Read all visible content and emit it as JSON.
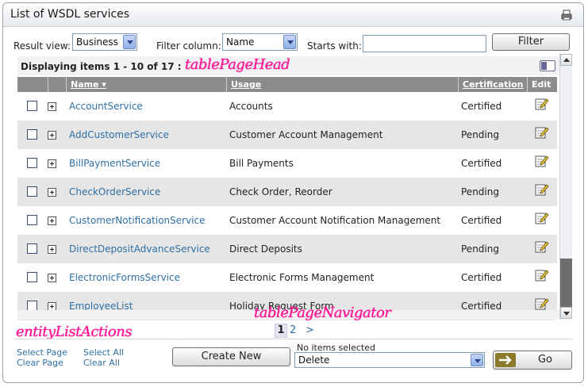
{
  "panel": {
    "title": "List of WSDL services",
    "print_icon": "printer-icon"
  },
  "filters": {
    "result_view_label": "Result view:",
    "result_view_value": "Business",
    "filter_column_label": "Filter column:",
    "filter_column_value": "Name",
    "starts_with_label": "Starts with:",
    "starts_with_value": "",
    "filter_button": "Filter"
  },
  "table": {
    "display_text": "Displaying items 1 - 10 of 17 :",
    "columns": {
      "name": "Name",
      "name_sort_indicator": "▾",
      "usage": "Usage",
      "certification": "Certification",
      "edit": "Edit"
    },
    "rows": [
      {
        "name": "AccountService",
        "usage": "Accounts",
        "certification": "Certified"
      },
      {
        "name": "AddCustomerService",
        "usage": "Customer Account Management",
        "certification": "Pending"
      },
      {
        "name": "BillPaymentService",
        "usage": "Bill Payments",
        "certification": "Certified"
      },
      {
        "name": "CheckOrderService",
        "usage": "Check Order, Reorder",
        "certification": "Pending"
      },
      {
        "name": "CustomerNotificationService",
        "usage": "Customer Account Notification Management",
        "certification": "Certified"
      },
      {
        "name": "DirectDepositAdvanceService",
        "usage": "Direct Deposits",
        "certification": "Pending"
      },
      {
        "name": "ElectronicFormsService",
        "usage": "Electronic Forms Management",
        "certification": "Certified"
      },
      {
        "name": "EmployeeList",
        "usage": "Holiday Request Form",
        "certification": "Certified"
      }
    ]
  },
  "pager": {
    "current": "1",
    "next_page": "2",
    "next_arrow": ">"
  },
  "annotations": {
    "table_page_head": "tablePageHead",
    "table_page_navigator": "tablePageNavigator",
    "entity_list_actions": "entityListActions"
  },
  "actions": {
    "select_page": "Select Page",
    "clear_page": "Clear Page",
    "select_all": "Select All",
    "clear_all": "Clear All",
    "create_new": "Create New",
    "selection_status": "No items selected",
    "action_value": "Delete",
    "go": "Go"
  },
  "colors": {
    "link": "#2f6fa5",
    "annotation": "#ff1493",
    "header_bg": "#8c8c8c",
    "alt_row": "#e6e6e6"
  }
}
